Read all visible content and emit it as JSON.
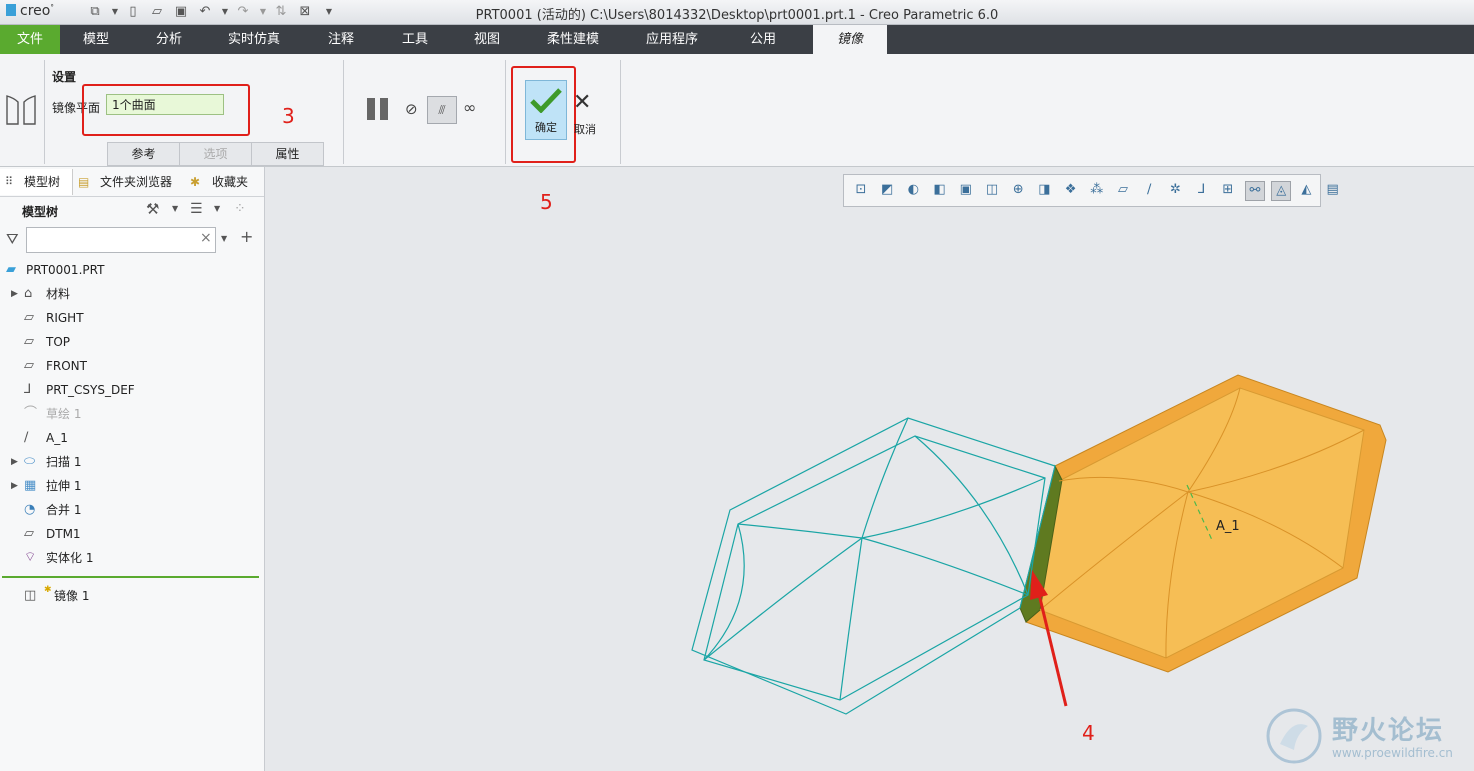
{
  "titlebar": {
    "logo": "creo",
    "title": "PRT0001 (活动的) C:\\Users\\8014332\\Desktop\\prt0001.prt.1 - Creo Parametric 6.0"
  },
  "tabs": [
    "文件",
    "模型",
    "分析",
    "实时仿真",
    "注释",
    "工具",
    "视图",
    "柔性建模",
    "应用程序",
    "公用",
    "镜像"
  ],
  "ribbon": {
    "settings_label": "设置",
    "mirror_plane_label": "镜像平面",
    "mirror_plane_value": "1个曲面",
    "subtabs": [
      "参考",
      "选项",
      "属性"
    ],
    "ok_label": "确定",
    "cancel_label": "取消"
  },
  "panel": {
    "tabs": [
      "模型树",
      "文件夹浏览器",
      "收藏夹"
    ],
    "tree_header": "模型树",
    "search_placeholder": "",
    "items": [
      {
        "label": "PRT0001.PRT",
        "icon": "part-icon"
      },
      {
        "label": "材料",
        "icon": "material-icon",
        "expandable": true
      },
      {
        "label": "RIGHT",
        "icon": "datum-plane-icon"
      },
      {
        "label": "TOP",
        "icon": "datum-plane-icon"
      },
      {
        "label": "FRONT",
        "icon": "datum-plane-icon"
      },
      {
        "label": "PRT_CSYS_DEF",
        "icon": "csys-icon"
      },
      {
        "label": "草绘 1",
        "icon": "sketch-icon",
        "dimmed": true
      },
      {
        "label": "A_1",
        "icon": "axis-icon"
      },
      {
        "label": "扫描 1",
        "icon": "sweep-icon",
        "expandable": true
      },
      {
        "label": "拉伸 1",
        "icon": "extrude-icon",
        "expandable": true
      },
      {
        "label": "合并 1",
        "icon": "merge-icon"
      },
      {
        "label": "DTM1",
        "icon": "datum-plane-icon"
      },
      {
        "label": "实体化 1",
        "icon": "solidify-icon"
      },
      {
        "label": "镜像 1",
        "icon": "mirror-icon"
      }
    ]
  },
  "graphics": {
    "axis_label": "A_1"
  },
  "annotations": {
    "n3": "3",
    "n4": "4",
    "n5": "5"
  },
  "watermark": {
    "title": "野火论坛",
    "url": "www.proewildfire.cn"
  },
  "colors": {
    "file_tab": "#5aaa2f",
    "tab_bar": "#3b3f45",
    "surface_fill": "#f5b943",
    "wireframe": "#1aa5a5",
    "annotation": "#e0201a",
    "ok_highlight": "#bfe3f7"
  }
}
